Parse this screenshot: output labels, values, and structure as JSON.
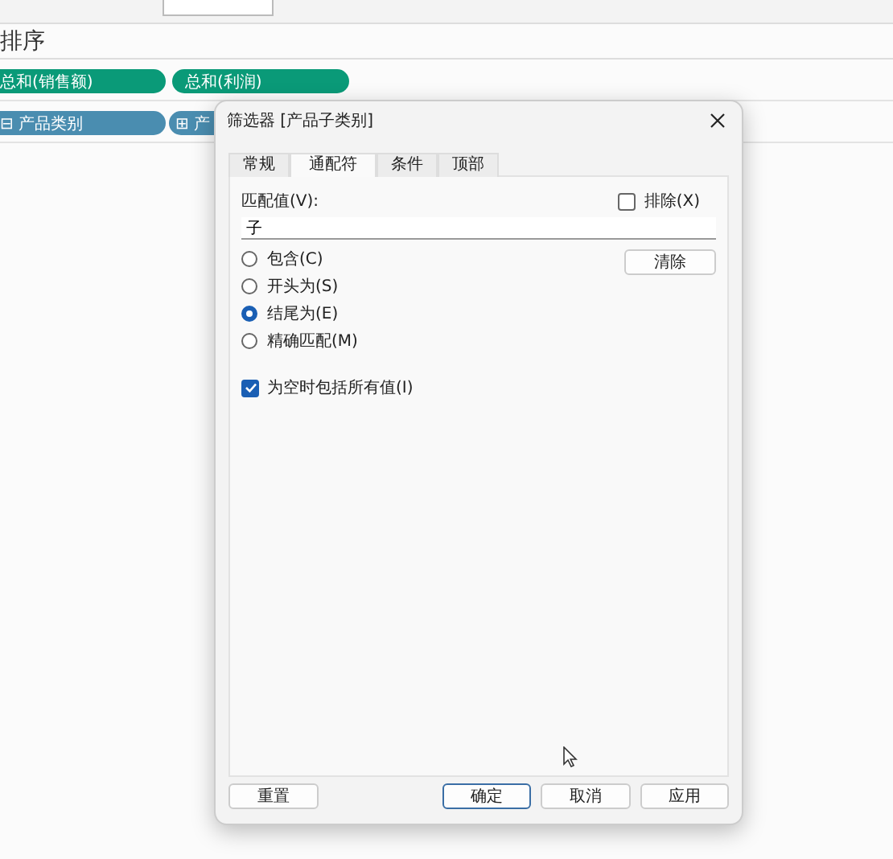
{
  "sheet": {
    "heading": "排序",
    "rows": [
      {
        "pills": [
          {
            "label": "总和(销售额)",
            "kind": "measure"
          },
          {
            "label": "总和(利润)",
            "kind": "measure"
          }
        ]
      },
      {
        "pills": [
          {
            "label": "⊟ 产品类别",
            "kind": "dimension"
          },
          {
            "label": "⊞ 产",
            "kind": "dimension"
          }
        ]
      }
    ]
  },
  "dialog": {
    "title": "筛选器 [产品子类别]",
    "tabs": [
      {
        "label": "常规",
        "selected": false
      },
      {
        "label": "通配符",
        "selected": true
      },
      {
        "label": "条件",
        "selected": false
      },
      {
        "label": "顶部",
        "selected": false
      }
    ],
    "match_label": "匹配值(V):",
    "exclude": {
      "label": "排除(X)",
      "checked": false
    },
    "match_value": "子",
    "clear_button": "清除",
    "options": [
      {
        "label": "包含(C)",
        "selected": false
      },
      {
        "label": "开头为(S)",
        "selected": false
      },
      {
        "label": "结尾为(E)",
        "selected": true
      },
      {
        "label": "精确匹配(M)",
        "selected": false
      }
    ],
    "include_all": {
      "label": "为空时包括所有值(I)",
      "checked": true
    },
    "buttons": [
      {
        "label": "重置",
        "default": false,
        "kind": "left"
      },
      {
        "label": "确定",
        "default": true,
        "kind": "right"
      },
      {
        "label": "取消",
        "default": false,
        "kind": "right"
      },
      {
        "label": "应用",
        "default": false,
        "kind": "right"
      }
    ]
  }
}
